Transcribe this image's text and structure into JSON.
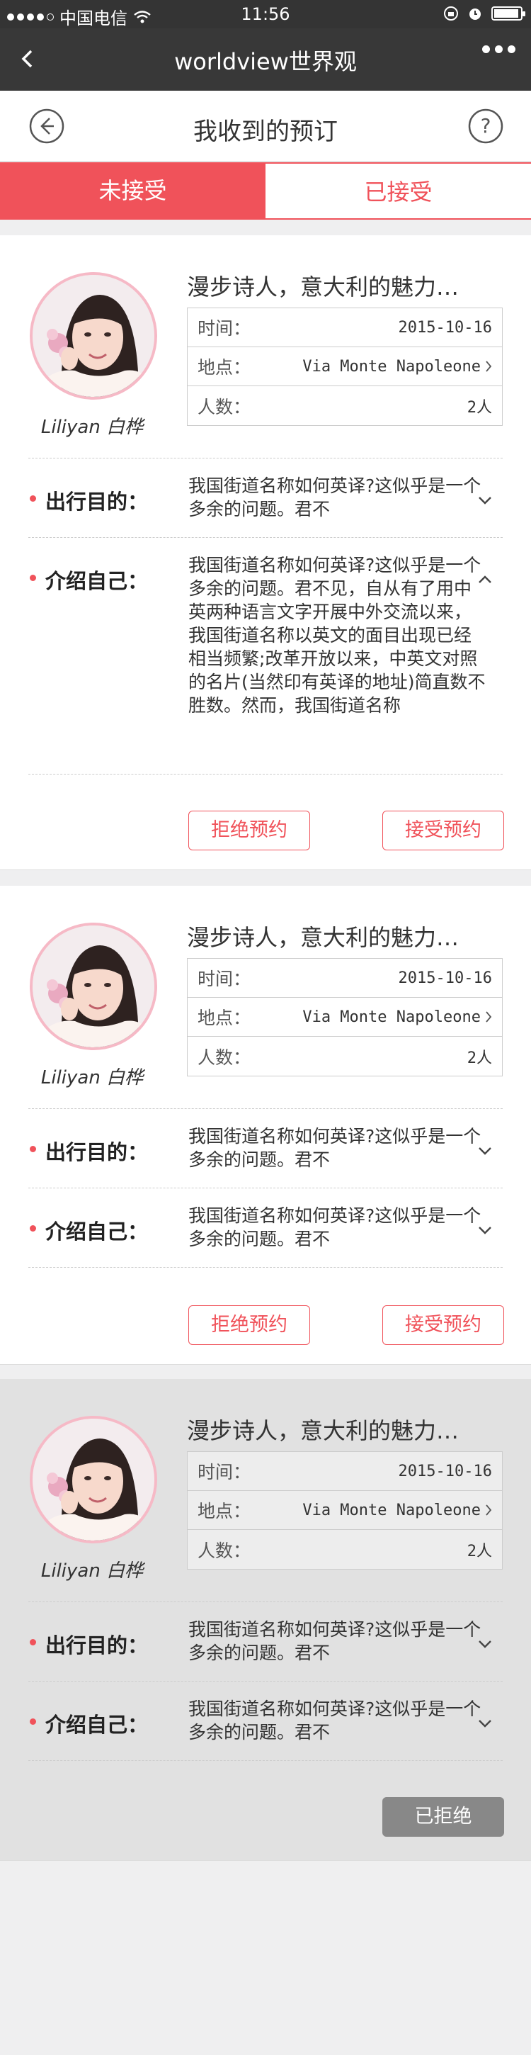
{
  "status": {
    "carrier": "中国电信",
    "time": "11:56"
  },
  "nav": {
    "title": "worldview世界观"
  },
  "page": {
    "title": "我收到的预订"
  },
  "tabs": [
    {
      "label": "未接受"
    },
    {
      "label": "已接受"
    }
  ],
  "cards": [
    {
      "name": "Liliyan 白桦",
      "title": "漫步诗人，意大利的魅力…",
      "info": [
        {
          "label": "时间：",
          "value": "2015-10-16"
        },
        {
          "label": "地点：",
          "value": "Via Monte Napoleone"
        },
        {
          "label": "人数：",
          "value": "2人"
        }
      ],
      "purpose_label": "出行目的：",
      "purpose_text": "我国街道名称如何英译?这似乎是一个多余的问题。君不",
      "intro_label": "介绍自己：",
      "intro_text": "我国街道名称如何英译?这似乎是一个多余的问题。君不见，自从有了用中英两种语言文字开展中外交流以来，我国街道名称以英文的面目出现已经相当频繁;改革开放以来，中英文对照的名片(当然印有英译的地址)简直数不胜数。然而，我国街道名称",
      "reject_label": "拒绝预约",
      "accept_label": "接受预约"
    },
    {
      "name": "Liliyan 白桦",
      "title": "漫步诗人，意大利的魅力…",
      "info": [
        {
          "label": "时间：",
          "value": "2015-10-16"
        },
        {
          "label": "地点：",
          "value": "Via Monte Napoleone"
        },
        {
          "label": "人数：",
          "value": "2人"
        }
      ],
      "purpose_label": "出行目的：",
      "purpose_text": "我国街道名称如何英译?这似乎是一个多余的问题。君不",
      "intro_label": "介绍自己：",
      "intro_text": "我国街道名称如何英译?这似乎是一个多余的问题。君不",
      "reject_label": "拒绝预约",
      "accept_label": "接受预约"
    },
    {
      "name": "Liliyan 白桦",
      "title": "漫步诗人，意大利的魅力…",
      "info": [
        {
          "label": "时间：",
          "value": "2015-10-16"
        },
        {
          "label": "地点：",
          "value": "Via Monte Napoleone"
        },
        {
          "label": "人数：",
          "value": "2人"
        }
      ],
      "purpose_label": "出行目的：",
      "purpose_text": "我国街道名称如何英译?这似乎是一个多余的问题。君不",
      "intro_label": "介绍自己：",
      "intro_text": "我国街道名称如何英译?这似乎是一个多余的问题。君不",
      "status_label": "已拒绝"
    }
  ],
  "colors": {
    "accent": "#f0525a",
    "nav_bg": "#383838",
    "avatar_border": "#f6b9c6"
  }
}
